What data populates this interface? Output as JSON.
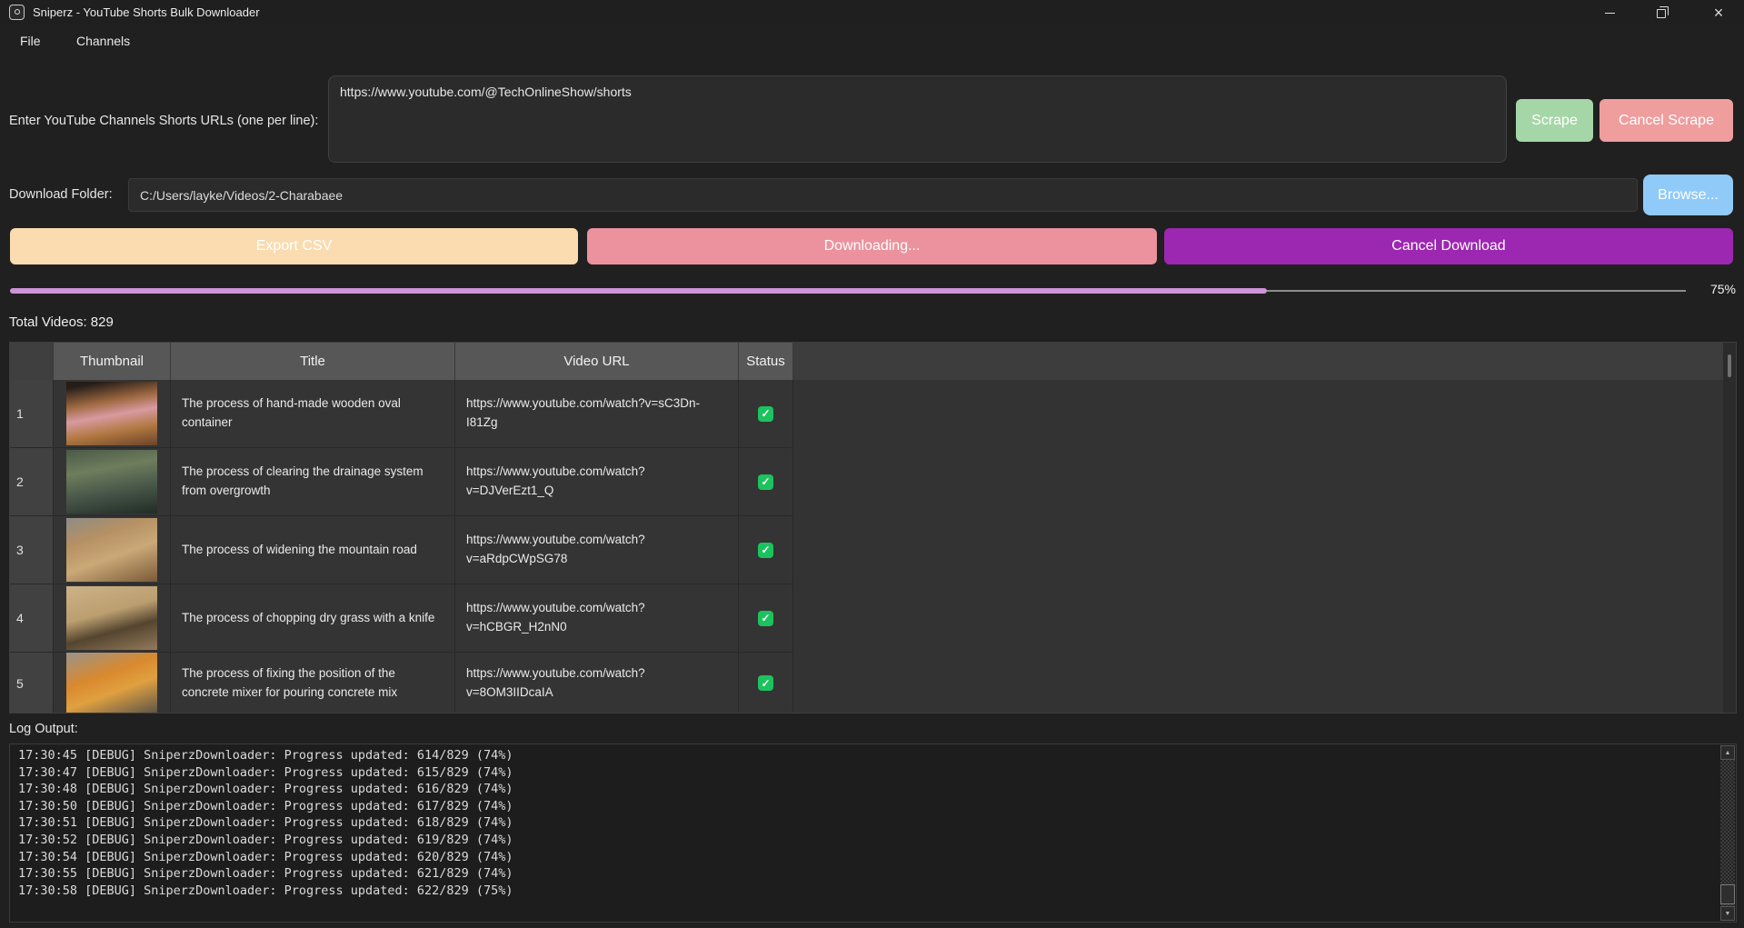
{
  "window": {
    "title": "Sniperz - YouTube Shorts Bulk Downloader",
    "controls": [
      "minimize",
      "maximize",
      "close"
    ]
  },
  "menu": {
    "items": [
      "File",
      "Channels"
    ]
  },
  "url_input": {
    "label": "Enter YouTube Channels Shorts URLs (one per line):",
    "value": "https://www.youtube.com/@TechOnlineShow/shorts"
  },
  "scrape": {
    "scrape_label": "Scrape",
    "cancel_label": "Cancel Scrape"
  },
  "download_folder": {
    "label": "Download Folder:",
    "value": "C:/Users/layke/Videos/2-Charabaee",
    "browse_label": "Browse..."
  },
  "actions": {
    "export_csv": "Export CSV",
    "downloading": "Downloading...",
    "cancel_download": "Cancel Download"
  },
  "progress": {
    "percent": 75,
    "label": "75%"
  },
  "totals": {
    "total_videos": "Total Videos: 829"
  },
  "table": {
    "headers": {
      "thumbnail": "Thumbnail",
      "title": "Title",
      "url": "Video URL",
      "status": "Status"
    },
    "check_glyph": "✓",
    "rows": [
      {
        "num": "1",
        "title": "The process of hand-made wooden oval container",
        "url": "https://www.youtube.com/watch?v=sC3Dn-I81Zg",
        "status": "completed",
        "thumb_gradient": "linear-gradient(170deg,#241d18 8%,#a06a42 34%,#d89aa0 52%,#b07840 74%,#6a422a 100%)"
      },
      {
        "num": "2",
        "title": "The process of clearing the drainage system from overgrowth",
        "url": "https://www.youtube.com/watch?v=DJVerEzt1_Q",
        "status": "completed",
        "thumb_gradient": "linear-gradient(170deg,#4a5a48 0%,#6e7d5c 32%,#49584a 62%,#202c26 100%)"
      },
      {
        "num": "3",
        "title": "The process of widening the mountain road",
        "url": "https://www.youtube.com/watch?v=aRdpCWpSG78",
        "status": "completed",
        "thumb_gradient": "linear-gradient(160deg,#8d8d88 0%,#b59063 30%,#caa877 58%,#7a5a38 100%)"
      },
      {
        "num": "4",
        "title": "The process of chopping dry grass with a knife",
        "url": "https://www.youtube.com/watch?v=hCBGR_H2nN0",
        "status": "completed",
        "thumb_gradient": "linear-gradient(165deg,#cdb288 0%,#bb9f70 42%,#54452f 66%,#93795a 100%)"
      },
      {
        "num": "5",
        "title": "The process of fixing the position of the concrete mixer for pouring concrete mix",
        "url": "https://www.youtube.com/watch?v=8OM3IIDcaIA",
        "status": "completed",
        "thumb_gradient": "linear-gradient(160deg,#98948e 0%,#d9892e 38%,#e0a040 60%,#555048 100%)"
      }
    ]
  },
  "log": {
    "label": "Log Output:",
    "lines": [
      "17:30:45 [DEBUG] SniperzDownloader: Progress updated: 614/829 (74%)",
      "17:30:47 [DEBUG] SniperzDownloader: Progress updated: 615/829 (74%)",
      "17:30:48 [DEBUG] SniperzDownloader: Progress updated: 616/829 (74%)",
      "17:30:50 [DEBUG] SniperzDownloader: Progress updated: 617/829 (74%)",
      "17:30:51 [DEBUG] SniperzDownloader: Progress updated: 618/829 (74%)",
      "17:30:52 [DEBUG] SniperzDownloader: Progress updated: 619/829 (74%)",
      "17:30:54 [DEBUG] SniperzDownloader: Progress updated: 620/829 (74%)",
      "17:30:55 [DEBUG] SniperzDownloader: Progress updated: 621/829 (74%)",
      "17:30:58 [DEBUG] SniperzDownloader: Progress updated: 622/829 (75%)"
    ]
  },
  "colors": {
    "background": "#202020",
    "field_background": "#2b2b2b",
    "scrape_green": "#a5d6a7",
    "cancel_scrape_pink": "#ef9d9d",
    "browse_blue": "#90caf9",
    "export_peach": "#fadcb0",
    "downloading_pink": "#ec929e",
    "cancel_download_purple": "#9c27b0",
    "progress_plum": "#ce93d8",
    "table_header_gray": "#575757",
    "status_check_green": "#1cc25e"
  }
}
